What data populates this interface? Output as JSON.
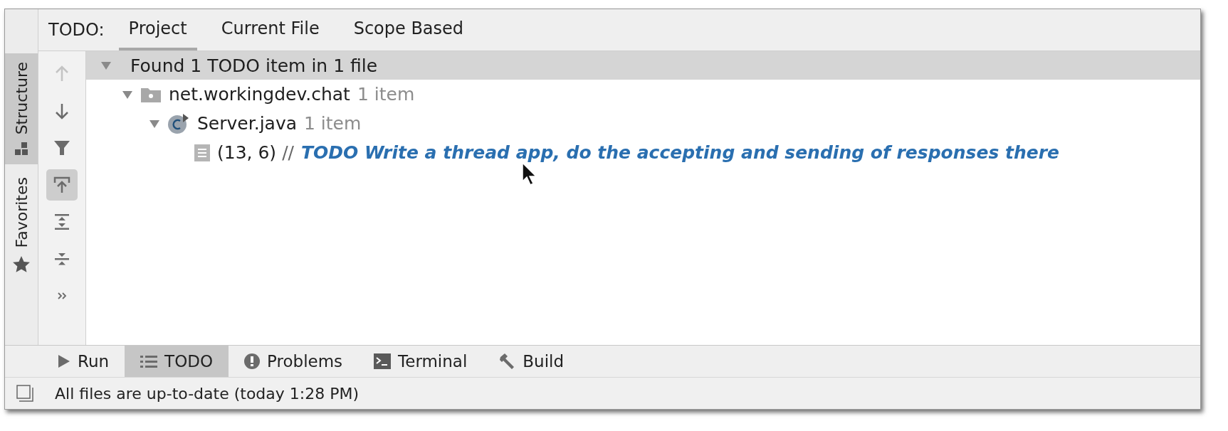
{
  "tool_window": {
    "title": "TODO:",
    "tabs": [
      {
        "label": "Project",
        "selected": true
      },
      {
        "label": "Current File",
        "selected": false
      },
      {
        "label": "Scope Based",
        "selected": false
      }
    ]
  },
  "side_tabs": [
    {
      "kind": "structure",
      "label": "Structure",
      "selected": true
    },
    {
      "kind": "favorites",
      "label": "Favorites",
      "selected": false
    }
  ],
  "toolbar": [
    {
      "kind": "up",
      "disabled": true,
      "on": false
    },
    {
      "kind": "down",
      "disabled": false,
      "on": false
    },
    {
      "kind": "filter",
      "disabled": false,
      "on": false
    },
    {
      "kind": "autoscroll",
      "disabled": false,
      "on": true
    },
    {
      "kind": "expand",
      "disabled": false,
      "on": false
    },
    {
      "kind": "collapse",
      "disabled": false,
      "on": false
    },
    {
      "kind": "more",
      "disabled": false,
      "on": false
    }
  ],
  "tree": {
    "summary": "Found 1 TODO item in 1 file",
    "expanded": true,
    "children": [
      {
        "kind": "package",
        "name": "net.workingdev.chat",
        "count": "1 item",
        "expanded": true,
        "children": [
          {
            "kind": "class",
            "name": "Server.java",
            "count": "1 item",
            "expanded": true,
            "children": [
              {
                "kind": "todo",
                "position": "(13, 6)",
                "prefix": "//",
                "text": "TODO Write a thread app, do the accepting and sending of responses there"
              }
            ]
          }
        ]
      }
    ]
  },
  "bottom_tabs": [
    {
      "kind": "run",
      "label": "Run",
      "selected": false
    },
    {
      "kind": "todo",
      "label": "TODO",
      "selected": true
    },
    {
      "kind": "problems",
      "label": "Problems",
      "selected": false
    },
    {
      "kind": "terminal",
      "label": "Terminal",
      "selected": false
    },
    {
      "kind": "build",
      "label": "Build",
      "selected": false
    }
  ],
  "status_bar": {
    "text": "All files are up-to-date (today 1:28 PM)"
  }
}
